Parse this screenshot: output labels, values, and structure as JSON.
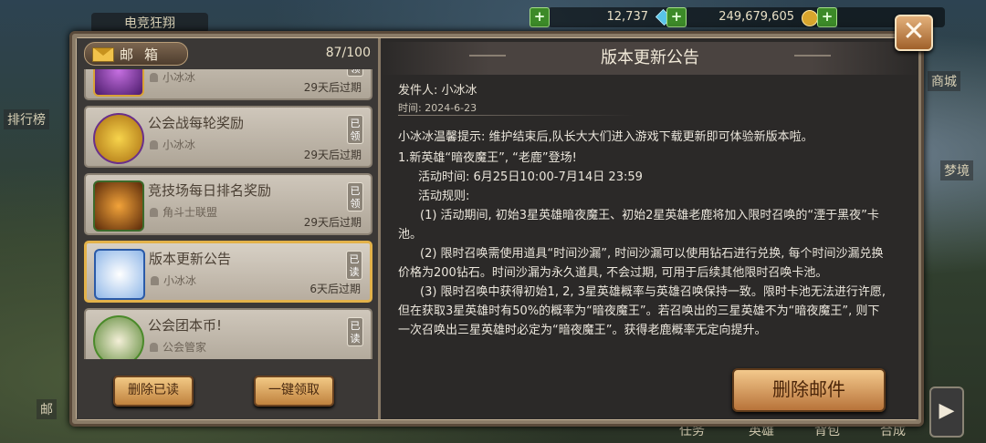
{
  "hud": {
    "event_banner": "电竞狂翔",
    "gems": "12,737",
    "gold": "249,679,605",
    "left_labels": [
      "排行榜",
      "邮"
    ],
    "right_labels": [
      "商城",
      "梦境"
    ],
    "bottom_tabs": [
      "任务",
      "英雄",
      "背包",
      "合成"
    ]
  },
  "mailbox": {
    "title": "邮箱",
    "count": "87/100",
    "items": [
      {
        "title": "",
        "sender": "小冰冰",
        "expiry": "29天后过期",
        "badge": "已领"
      },
      {
        "title": "公会战每轮奖励",
        "sender": "小冰冰",
        "expiry": "29天后过期",
        "badge": "已领"
      },
      {
        "title": "竞技场每日排名奖励",
        "sender": "角斗士联盟",
        "expiry": "29天后过期",
        "badge": "已领"
      },
      {
        "title": "版本更新公告",
        "sender": "小冰冰",
        "expiry": "6天后过期",
        "badge": "已读"
      },
      {
        "title": "公会团本币!",
        "sender": "公会管家",
        "expiry": "",
        "badge": "已读"
      }
    ],
    "delete_read_label": "删除已读",
    "collect_all_label": "一键领取"
  },
  "notice": {
    "title": "版本更新公告",
    "sender_label": "发件人: 小冰冰",
    "time_label": "时间: 2024-6-23",
    "paragraphs": [
      "小冰冰温馨提示: 维护结束后,队长大大们进入游戏下载更新即可体验新版本啦。",
      "1.新英雄“暗夜魔王”, “老鹿”登场!",
      "活动时间: 6月25日10:00-7月14日 23:59",
      "活动规则:",
      "(1) 活动期间, 初始3星英雄暗夜魔王、初始2星英雄老鹿将加入限时召唤的“湮于黑夜”卡池。",
      "(2) 限时召唤需使用道具“时间沙漏”, 时间沙漏可以使用钻石进行兑换, 每个时间沙漏兑换价格为200钻石。时间沙漏为永久道具, 不会过期, 可用于后续其他限时召唤卡池。",
      "(3) 限时召唤中获得初始1, 2, 3星英雄概率与英雄召唤保持一致。限时卡池无法进行许愿, 但在获取3星英雄时有50%的概率为“暗夜魔王”。若召唤出的三星英雄不为“暗夜魔王”, 则下一次召唤出三星英雄时必定为“暗夜魔王”。获得老鹿概率无定向提升。"
    ],
    "delete_mail_label": "删除邮件"
  },
  "colors": {
    "accent_gold": "#e3b24a",
    "button_orange": "#f2c985",
    "text_light": "#ebe6dc"
  }
}
